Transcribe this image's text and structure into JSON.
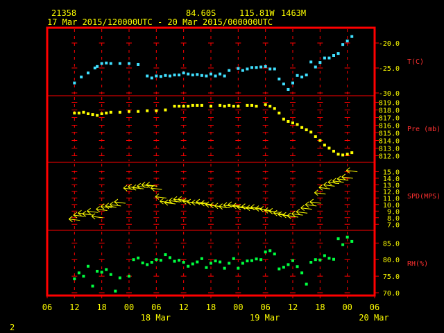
{
  "header": {
    "station_id": "21358",
    "lat": "84.60S",
    "lon": "115.81W",
    "elev": "1463M",
    "time_range": "17 Mar 2015/120000UTC - 20 Mar 2015/000000UTC"
  },
  "footer": {
    "page_number": "2"
  },
  "colors": {
    "frame": "#ff0000",
    "grid": "#ff0000",
    "text_axis": "#ffff00",
    "panel_label": "#ff3030",
    "temperature": "#40e0ff",
    "pressure": "#ffff00",
    "wind": "#ffff00",
    "rh": "#00ff40"
  },
  "chart_data": {
    "type": "scatter",
    "x_unit": "hours from 17 Mar 2015 00 UTC",
    "x_range": [
      6,
      78
    ],
    "x_ticks": [
      6,
      12,
      18,
      24,
      30,
      36,
      42,
      48,
      54,
      60,
      66,
      72,
      78
    ],
    "x_tick_labels": [
      "06",
      "12",
      "18",
      "00",
      "06",
      "12",
      "18",
      "00",
      "06",
      "12",
      "18",
      "00",
      "06"
    ],
    "date_labels": [
      {
        "hour": 30,
        "text": "18 Mar"
      },
      {
        "hour": 54,
        "text": "19 Mar"
      },
      {
        "hour": 78,
        "text": "20 Mar"
      }
    ],
    "panels": [
      {
        "id": "temperature",
        "label": "T(C)",
        "marker": "square",
        "color_key": "temperature",
        "range": [
          -30,
          -17.5
        ],
        "ticks": [
          -20.0,
          -25.0,
          -30.0
        ],
        "tick_labels": [
          "-20.0",
          "-25.0",
          "-30.0"
        ],
        "x": [
          12,
          13.5,
          15,
          16.5,
          17,
          18,
          19,
          20,
          22,
          24,
          26,
          28,
          29,
          30,
          31,
          32,
          33,
          34,
          35,
          36,
          37,
          38,
          39,
          40,
          41,
          42,
          43,
          44,
          45,
          46,
          48,
          49,
          50,
          51,
          52,
          53,
          54,
          55,
          56,
          57,
          58,
          59,
          60,
          61,
          62,
          63,
          64,
          65,
          66,
          67,
          68,
          69,
          70,
          71,
          72,
          73
        ],
        "y": [
          -28.0,
          -26.8,
          -26.0,
          -25.0,
          -24.7,
          -24.1,
          -24.0,
          -24.1,
          -24.1,
          -24.1,
          -24.3,
          -26.6,
          -27.0,
          -26.6,
          -26.7,
          -26.5,
          -26.6,
          -26.4,
          -26.4,
          -26.0,
          -26.2,
          -26.4,
          -26.3,
          -26.5,
          -26.6,
          -26.2,
          -26.6,
          -26.2,
          -26.6,
          -25.5,
          -25.1,
          -25.5,
          -25.2,
          -24.9,
          -24.9,
          -24.8,
          -24.7,
          -25.2,
          -25.2,
          -27.2,
          -28.2,
          -29.3,
          -28.0,
          -26.5,
          -26.8,
          -26.4,
          -23.8,
          -24.8,
          -23.9,
          -23.0,
          -23.0,
          -22.5,
          -22.1,
          -20.3,
          -19.6,
          -18.7
        ]
      },
      {
        "id": "pressure",
        "label": "Pre (mb)",
        "marker": "square",
        "color_key": "pressure",
        "range": [
          811.5,
          819.5
        ],
        "ticks": [
          819.0,
          818.0,
          817.0,
          816.0,
          815.0,
          814.0,
          813.0,
          812.0
        ],
        "tick_labels": [
          "819.0",
          "818.0",
          "817.0",
          "816.0",
          "815.0",
          "814.0",
          "813.0",
          "812.0"
        ],
        "x": [
          12,
          13,
          14,
          15,
          16,
          17,
          18,
          19,
          20,
          22,
          24,
          26,
          28,
          30,
          32,
          34,
          35,
          36,
          37,
          38,
          39,
          40,
          42,
          44,
          45,
          46,
          47,
          48,
          50,
          51,
          52,
          54,
          55,
          56,
          57,
          58,
          59,
          60,
          61,
          62,
          63,
          64,
          65,
          66,
          67,
          68,
          69,
          70,
          71,
          72,
          73
        ],
        "y": [
          817.6,
          817.6,
          817.7,
          817.5,
          817.4,
          817.3,
          817.5,
          817.6,
          817.7,
          817.7,
          817.8,
          817.8,
          817.9,
          817.9,
          818.0,
          818.5,
          818.5,
          818.5,
          818.5,
          818.6,
          818.6,
          818.6,
          818.5,
          818.6,
          818.5,
          818.6,
          818.5,
          818.5,
          818.6,
          818.6,
          818.5,
          818.7,
          818.5,
          818.2,
          817.6,
          816.8,
          816.5,
          816.3,
          816.1,
          815.7,
          815.4,
          815.1,
          814.5,
          814.0,
          813.4,
          813.0,
          812.6,
          812.2,
          812.1,
          812.2,
          812.4
        ]
      },
      {
        "id": "wind",
        "label": "SPD(MPS)",
        "marker": "wind-barb",
        "color_key": "wind",
        "range": [
          6.5,
          16.0
        ],
        "ticks": [
          15.0,
          14.0,
          13.0,
          12.0,
          11.0,
          10.0,
          9.0,
          8.0,
          7.0
        ],
        "tick_labels": [
          "15.0",
          "14.0",
          "13.0",
          "12.0",
          "11.0",
          "10.0",
          "9.0",
          "8.0",
          "7.0"
        ],
        "x": [
          12,
          13,
          14,
          15,
          16,
          17,
          18,
          19,
          20,
          21,
          22,
          24,
          25,
          26,
          27,
          28,
          29,
          30,
          31,
          32,
          33,
          34,
          35,
          36,
          37,
          38,
          39,
          40,
          41,
          42,
          43,
          44,
          45,
          46,
          47,
          48,
          49,
          50,
          51,
          52,
          53,
          54,
          55,
          56,
          57,
          58,
          59,
          60,
          61,
          62,
          63,
          64,
          65,
          66,
          67,
          68,
          69,
          70,
          71,
          72,
          73
        ],
        "y": [
          7.8,
          8.4,
          8.7,
          8.6,
          9.0,
          8.2,
          9.3,
          9.7,
          9.8,
          10.0,
          10.4,
          12.5,
          12.7,
          12.6,
          12.8,
          13.0,
          13.0,
          12.5,
          11.2,
          10.5,
          10.3,
          10.6,
          10.8,
          10.8,
          10.5,
          10.4,
          10.3,
          10.4,
          10.2,
          10.0,
          9.9,
          9.8,
          9.7,
          9.9,
          10.0,
          9.8,
          9.6,
          9.7,
          9.5,
          9.6,
          9.4,
          9.3,
          9.1,
          9.0,
          8.7,
          8.5,
          8.4,
          8.3,
          8.6,
          8.9,
          9.5,
          10.0,
          10.4,
          11.8,
          12.6,
          13.0,
          13.4,
          13.6,
          13.9,
          14.2,
          15.2
        ]
      },
      {
        "id": "rh",
        "label": "RH(%)",
        "marker": "square",
        "color_key": "rh",
        "range": [
          70,
          88
        ],
        "ticks": [
          85.0,
          80.0,
          75.0,
          70.0
        ],
        "tick_labels": [
          "85.0",
          "80.0",
          "75.0",
          "70.0"
        ],
        "x": [
          12,
          13,
          14,
          15,
          16,
          17,
          18,
          19,
          20,
          21,
          22,
          24,
          25,
          26,
          27,
          28,
          29,
          30,
          31,
          32,
          33,
          34,
          35,
          36,
          37,
          38,
          39,
          40,
          41,
          42,
          43,
          44,
          45,
          46,
          47,
          48,
          49,
          50,
          51,
          52,
          53,
          54,
          55,
          56,
          57,
          58,
          59,
          60,
          61,
          62,
          63,
          64,
          65,
          66,
          67,
          68,
          69,
          70,
          71,
          72,
          73
        ],
        "y": [
          74.2,
          76.0,
          75.0,
          78.0,
          72.0,
          76.5,
          76.2,
          77.0,
          75.5,
          70.5,
          74.5,
          75.0,
          80.0,
          80.5,
          79.0,
          78.5,
          79.2,
          80.0,
          79.8,
          81.5,
          80.6,
          79.5,
          79.8,
          79.2,
          78.0,
          78.7,
          79.3,
          80.3,
          77.6,
          78.9,
          79.6,
          79.3,
          77.4,
          78.9,
          80.3,
          77.4,
          78.9,
          79.6,
          79.7,
          80.2,
          80.0,
          82.3,
          82.7,
          81.7,
          77.2,
          77.7,
          78.5,
          79.7,
          77.9,
          76.0,
          72.6,
          79.2,
          80.0,
          79.9,
          81.2,
          80.4,
          80.1,
          86.3,
          84.5,
          86.8,
          85.5
        ]
      }
    ]
  }
}
